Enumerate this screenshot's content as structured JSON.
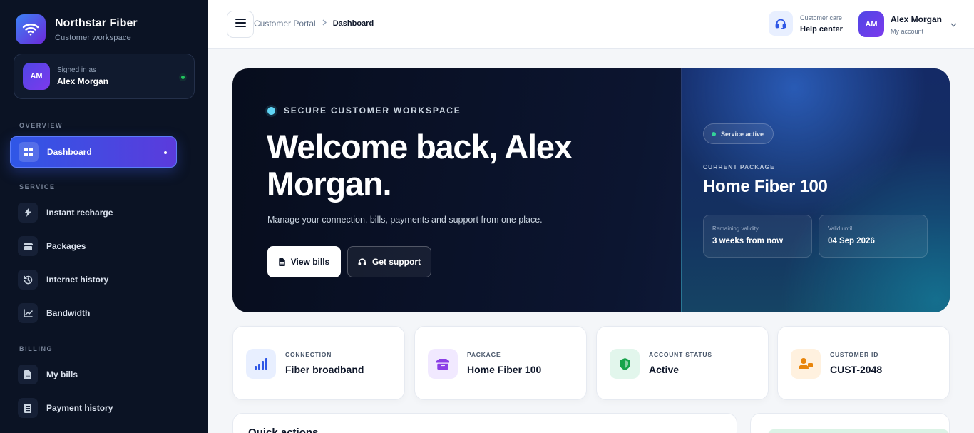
{
  "brand": {
    "name": "Northstar Fiber",
    "subtitle": "Customer workspace"
  },
  "sidebar": {
    "user": {
      "initials": "AM",
      "signed_label": "Signed in as",
      "name": "Alex Morgan"
    },
    "sections": {
      "overview": "OVERVIEW",
      "service": "SERVICE",
      "billing": "BILLING"
    },
    "items": [
      {
        "label": "Dashboard",
        "icon": "grid-icon",
        "active": true
      },
      {
        "label": "Instant recharge",
        "icon": "bolt-icon"
      },
      {
        "label": "Packages",
        "icon": "box-icon"
      },
      {
        "label": "Internet history",
        "icon": "history-icon"
      },
      {
        "label": "Bandwidth",
        "icon": "chart-line-icon"
      },
      {
        "label": "My bills",
        "icon": "file-icon"
      },
      {
        "label": "Payment history",
        "icon": "receipt-icon"
      }
    ]
  },
  "topbar": {
    "breadcrumb": [
      "Customer Portal",
      "Dashboard"
    ],
    "help": {
      "label": "Customer care",
      "title": "Help center"
    },
    "account": {
      "initials": "AM",
      "name": "Alex Morgan",
      "sub": "My account"
    }
  },
  "hero": {
    "eyebrow": "SECURE CUSTOMER WORKSPACE",
    "title": "Welcome back, Alex Morgan.",
    "description": "Manage your connection, bills, payments and support from one place.",
    "primary_button": "View bills",
    "secondary_button": "Get support",
    "service_status": "Service active",
    "package_label": "CURRENT PACKAGE",
    "package_name": "Home Fiber 100",
    "validity": {
      "label": "Remaining validity",
      "value": "3 weeks from now"
    },
    "valid_until": {
      "label": "Valid until",
      "value": "04 Sep 2026"
    }
  },
  "stats": [
    {
      "label": "CONNECTION",
      "value": "Fiber broadband",
      "icon": "signal-icon",
      "bg": "#e8efff"
    },
    {
      "label": "PACKAGE",
      "value": "Home Fiber 100",
      "icon": "package-icon",
      "bg": "#f1e9ff"
    },
    {
      "label": "ACCOUNT STATUS",
      "value": "Active",
      "icon": "shield-icon",
      "bg": "#e2f6ec"
    },
    {
      "label": "CUSTOMER ID",
      "value": "CUST-2048",
      "icon": "user-id-icon",
      "bg": "#fff1df"
    }
  ],
  "quick_actions": {
    "title": "Quick actions"
  },
  "colors": {
    "accent": "#2f57e6",
    "sidebar": "#0b1324",
    "online": "#22c55e"
  }
}
